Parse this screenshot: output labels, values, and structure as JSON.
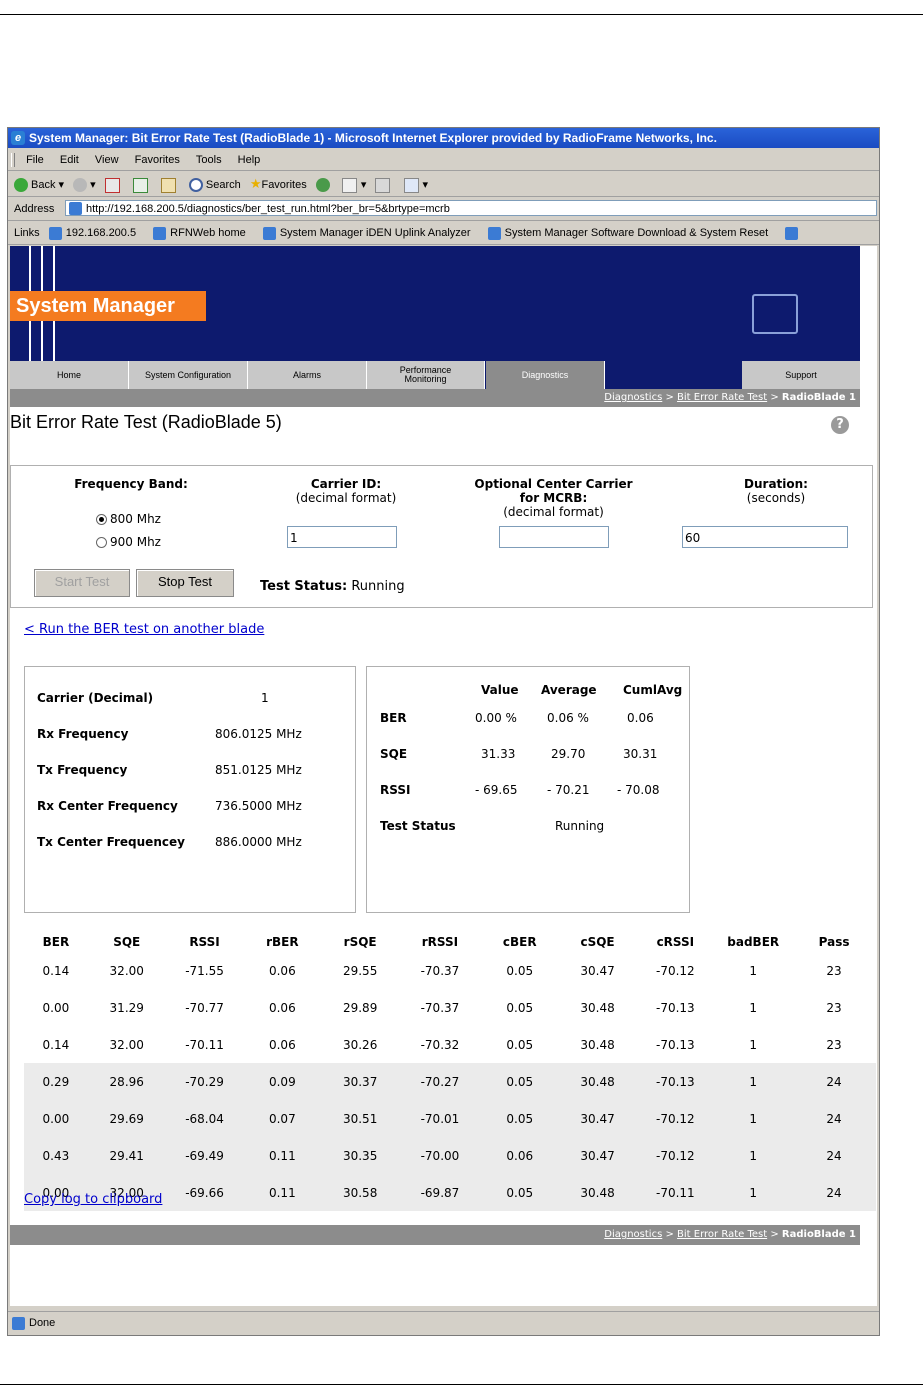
{
  "window": {
    "title": "System Manager: Bit Error Rate Test (RadioBlade 1) - Microsoft Internet Explorer provided by RadioFrame Networks, Inc."
  },
  "menu": [
    "File",
    "Edit",
    "View",
    "Favorites",
    "Tools",
    "Help"
  ],
  "toolbar": {
    "back": "Back",
    "search": "Search",
    "favorites": "Favorites"
  },
  "address": {
    "label": "Address",
    "url": "http://192.168.200.5/diagnostics/ber_test_run.html?ber_br=5&brtype=mcrb"
  },
  "links": {
    "label": "Links",
    "items": [
      "192.168.200.5",
      "RFNWeb home",
      "System Manager iDEN Uplink Analyzer",
      "System Manager Software Download & System Reset"
    ]
  },
  "app": {
    "logo": "System Manager",
    "tabs": [
      "Home",
      "System Configuration",
      "Alarms",
      "Performance Monitoring",
      "Diagnostics",
      "",
      "Support"
    ],
    "active_tab": "Diagnostics",
    "breadcrumb": {
      "diagnostics": "Diagnostics",
      "ber": "Bit Error Rate Test",
      "current": "RadioBlade 1",
      "sep": ">"
    }
  },
  "page": {
    "title": "Bit Error Rate Test (RadioBlade 5)",
    "help": "?"
  },
  "form": {
    "frequency_band_label": "Frequency Band:",
    "band_options": [
      "800 Mhz",
      "900 Mhz"
    ],
    "band_selected": "800 Mhz",
    "carrier_label": "Carrier ID:",
    "carrier_sub": "(decimal format)",
    "carrier_value": "1",
    "center_label_1": "Optional Center Carrier",
    "center_label_2": "for MCRB:",
    "center_sub": "(decimal format)",
    "center_value": "",
    "duration_label": "Duration:",
    "duration_sub": "(seconds)",
    "duration_value": "60",
    "start_label": "Start Test",
    "stop_label": "Stop Test",
    "status_label": "Test Status:",
    "status_value": "Running"
  },
  "run_other_link": "< Run the BER test on another blade",
  "carrier_info": {
    "rows": [
      {
        "label": "Carrier (Decimal)",
        "value": "1"
      },
      {
        "label": "Rx Frequency",
        "value": "806.0125 MHz"
      },
      {
        "label": "Tx Frequency",
        "value": "851.0125 MHz"
      },
      {
        "label": "Rx Center Frequency",
        "value": "736.5000 MHz"
      },
      {
        "label": "Tx Center Frequencey",
        "value": "886.0000 MHz"
      }
    ]
  },
  "results": {
    "headers": [
      "Value",
      "Average",
      "CumlAvg"
    ],
    "rows": [
      {
        "label": "BER",
        "value": "0.00 %",
        "average": "0.06 %",
        "cumlavg": "0.06"
      },
      {
        "label": "SQE",
        "value": "31.33",
        "average": "29.70",
        "cumlavg": "30.31"
      },
      {
        "label": "RSSI",
        "value": "- 69.65",
        "average": "- 70.21",
        "cumlavg": "- 70.08"
      }
    ],
    "status_label": "Test Status",
    "status_value": "Running"
  },
  "log": {
    "headers": [
      "BER",
      "SQE",
      "RSSI",
      "rBER",
      "rSQE",
      "rRSSI",
      "cBER",
      "cSQE",
      "cRSSI",
      "badBER",
      "Pass"
    ],
    "rows": [
      [
        "0.14",
        "32.00",
        "-71.55",
        "0.06",
        "29.55",
        "-70.37",
        "0.05",
        "30.47",
        "-70.12",
        "1",
        "23"
      ],
      [
        "0.00",
        "31.29",
        "-70.77",
        "0.06",
        "29.89",
        "-70.37",
        "0.05",
        "30.48",
        "-70.13",
        "1",
        "23"
      ],
      [
        "0.14",
        "32.00",
        "-70.11",
        "0.06",
        "30.26",
        "-70.32",
        "0.05",
        "30.48",
        "-70.13",
        "1",
        "23"
      ],
      [
        "0.29",
        "28.96",
        "-70.29",
        "0.09",
        "30.37",
        "-70.27",
        "0.05",
        "30.48",
        "-70.13",
        "1",
        "24"
      ],
      [
        "0.00",
        "29.69",
        "-68.04",
        "0.07",
        "30.51",
        "-70.01",
        "0.05",
        "30.47",
        "-70.12",
        "1",
        "24"
      ],
      [
        "0.43",
        "29.41",
        "-69.49",
        "0.11",
        "30.35",
        "-70.00",
        "0.06",
        "30.47",
        "-70.12",
        "1",
        "24"
      ],
      [
        "0.00",
        "32.00",
        "-69.66",
        "0.11",
        "30.58",
        "-69.87",
        "0.05",
        "30.48",
        "-70.11",
        "1",
        "24"
      ]
    ]
  },
  "copy_log_link": "Copy log to clipboard",
  "status_bar": "Done",
  "colors": {
    "banner": "#0d1a6e",
    "logo": "#f47b20",
    "tab": "#c8c8c8",
    "tab_active": "#8c8c8c",
    "link": "#0000cc"
  }
}
